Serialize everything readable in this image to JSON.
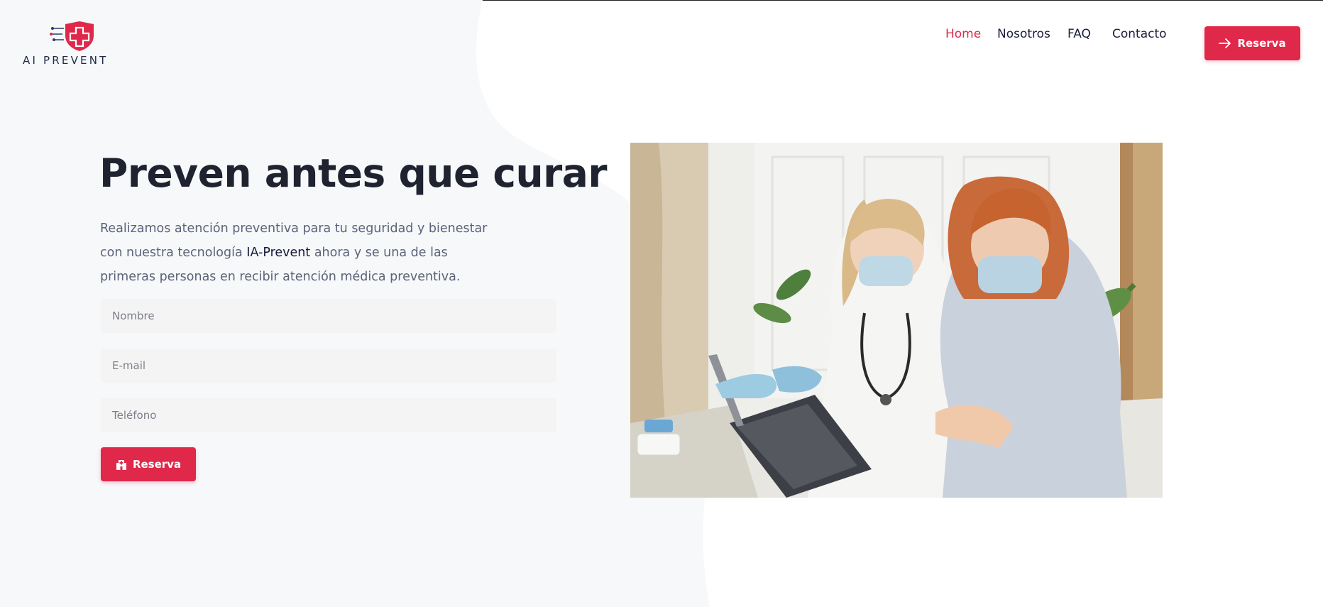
{
  "brand": {
    "name": "AI PREVENT",
    "accent_color": "#e0284a",
    "logo_icon": "shield-cross-icon"
  },
  "nav": {
    "items": [
      "Home",
      "Nosotros",
      "FAQ",
      "Contacto"
    ],
    "active": "Home"
  },
  "header": {
    "cta_label": "Reserva",
    "cta_icon": "arrow-right-icon"
  },
  "hero": {
    "title": "Preven antes que curar",
    "lead_before": "Realizamos atención preventiva para tu seguridad y bienestar con nuestra tecnología ",
    "lead_highlight": "IA-Prevent",
    "lead_after": " ahora y se una de las primeras personas en recibir atención médica preventiva."
  },
  "form": {
    "name_placeholder": "Nombre",
    "email_placeholder": "E-mail",
    "phone_placeholder": "Teléfono",
    "submit_label": "Reserva",
    "submit_icon": "hospital-icon"
  }
}
